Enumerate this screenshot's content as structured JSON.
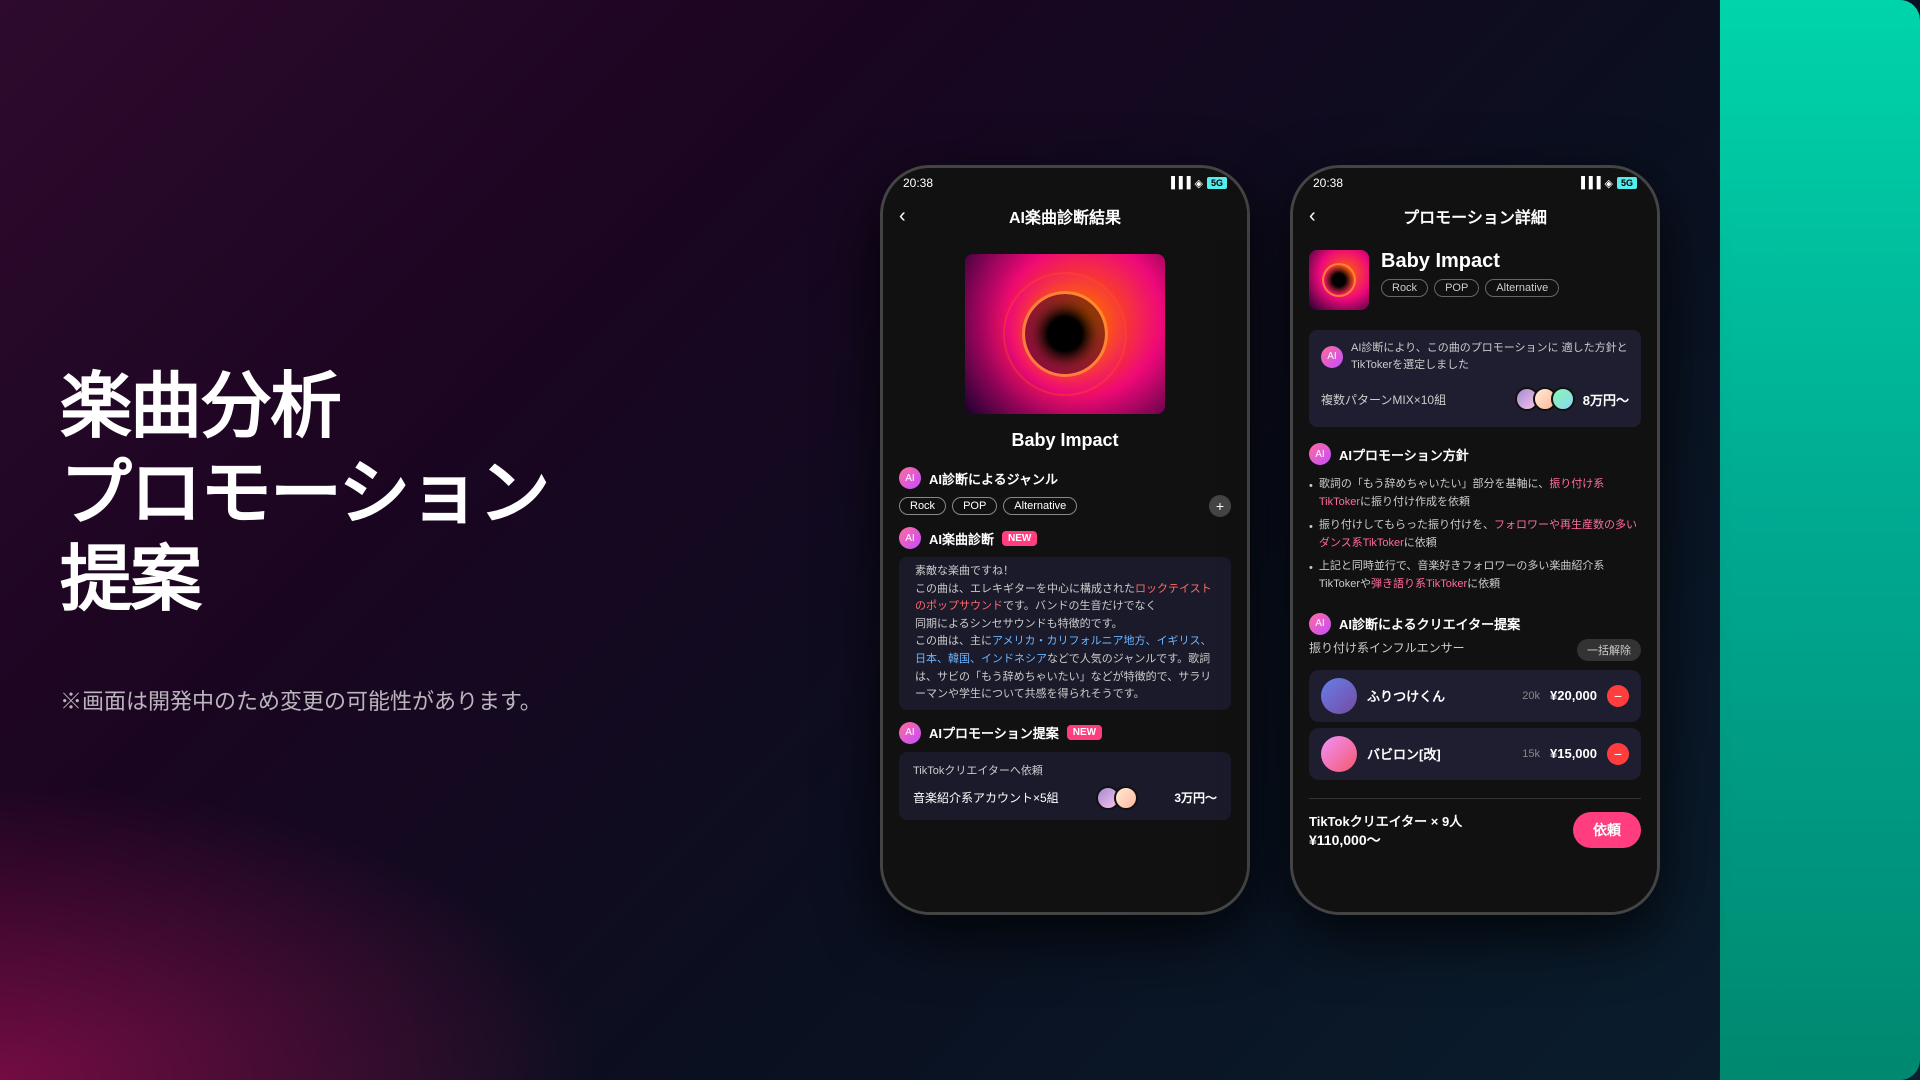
{
  "background": {
    "color": "#1a0a1e"
  },
  "left_panel": {
    "title_line1": "楽曲分析",
    "title_line2": "プロモーション提案",
    "disclaimer": "※画面は開発中のため変更の可能性があります。"
  },
  "phone1": {
    "status_time": "20:38",
    "header_title": "AI楽曲診断結果",
    "back_label": "‹",
    "song_title": "Baby Impact",
    "genre_section_label": "AI診断によるジャンル",
    "genres": [
      "Rock",
      "POP",
      "Alternative"
    ],
    "ai_diagnosis_label": "AI楽曲診断",
    "new_badge": "NEW",
    "diagnosis_text_part1": "素敵な楽曲ですね！\nこの曲は、エレキギターを中心に構成された",
    "diagnosis_highlight1": "ロックテイストのポップサウンド",
    "diagnosis_text_part2": "です。バンドの生音だけでなく\n同期によるシンセサウンドも特徴的です。\nこの曲は、主に",
    "diagnosis_highlight2": "アメリカ・カリフォルニア地方、イギリス、\n日本、韓国、インドネシア",
    "diagnosis_text_part3": "などで人気のジャンルです。歌詞は、サビの「もう辞めちゃいたい」などが特徴的で、サラリーマンや学生について共感を得られそうです。",
    "promo_proposal_label": "AIプロモーション提案",
    "promo_new_badge": "NEW",
    "tiktok_creator_label": "TikTokクリエイターへ依頼",
    "music_account_label": "音楽紹介系アカウント×5組",
    "music_account_price": "3万円〜"
  },
  "phone2": {
    "status_time": "20:38",
    "header_title": "プロモーション詳細",
    "back_label": "‹",
    "song_name": "Baby Impact",
    "genres": [
      "Rock",
      "POP",
      "Alternative"
    ],
    "ai_analysis_intro": "AI診断により、この曲のプロモーションに\n適した方針とTikTokerを選定しました",
    "multi_pattern_label": "複数パターンMIX×10組",
    "multi_pattern_price": "8万円〜",
    "ai_policy_label": "AIプロモーション方針",
    "policy_items": [
      {
        "text": "歌詞の「もう辞めちゃいたい」部分を基軸に、",
        "highlight": "振り付け系TikToker",
        "text2": "に振り付け作成を依頼"
      },
      {
        "text": "振り付けしてもらった振り付けを、",
        "highlight": "フォロワーや再生\n産数の多いダンス系TikToker",
        "text2": "に依頼"
      },
      {
        "text": "上記と同時並行で、音楽好きフォロワーの多い楽曲紹介系TikTokerや",
        "highlight": "弾き語り系TikToker",
        "text2": "に依頼"
      }
    ],
    "creator_suggestion_label": "AI診断によるクリエイター提案",
    "influencer_type_label": "振り付け系インフルエンサー",
    "dismiss_btn_label": "一括解除",
    "creators": [
      {
        "name": "ふりつけくん",
        "followers": "20k",
        "price": "¥20,000"
      },
      {
        "name": "バビロン[改]",
        "followers": "15k",
        "price": "¥15,000"
      }
    ],
    "tiktok_creator_count": "TikTokクリエイター × 9人",
    "total_price": "¥110,000〜",
    "request_btn_label": "依頼"
  }
}
